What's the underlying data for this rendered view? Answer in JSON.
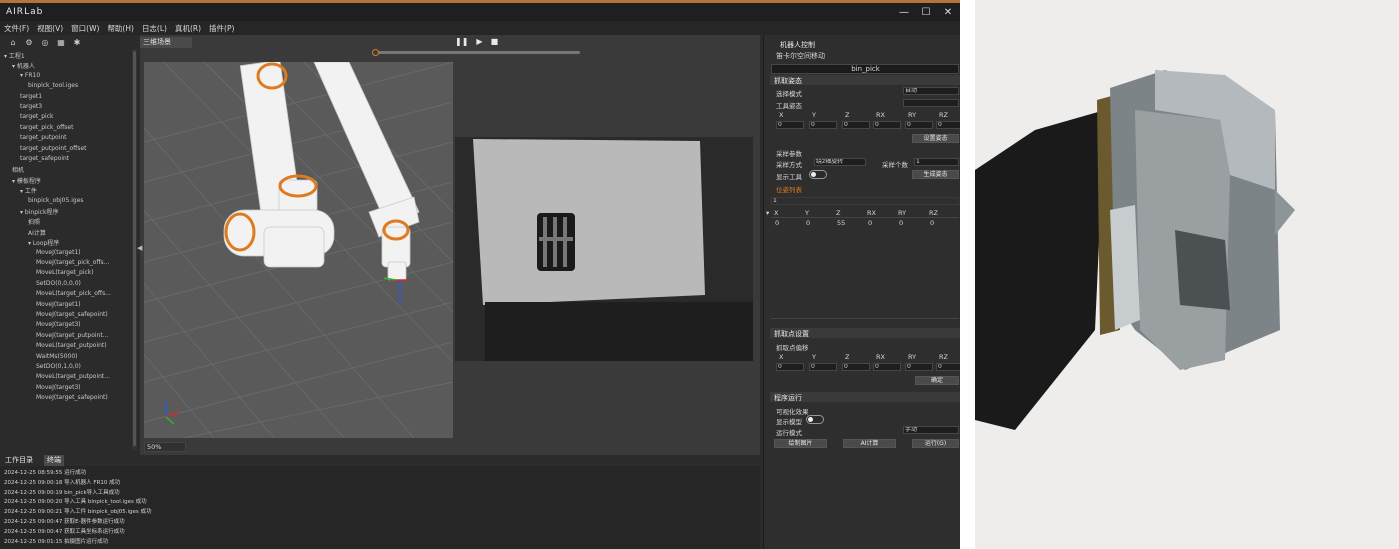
{
  "app": {
    "logo": "AIRLab",
    "window_buttons": [
      "—",
      "☐",
      "✕"
    ]
  },
  "menu": [
    "文件(F)",
    "视图(V)",
    "窗口(W)",
    "帮助(H)",
    "日志(L)",
    "真机(R)",
    "插件(P)"
  ],
  "toolbar_icons": [
    "home-icon",
    "gear-icon",
    "target-icon",
    "grid-icon",
    "settings-icon"
  ],
  "tree": [
    {
      "label": "工程1",
      "indent": 0,
      "arrow": "▾"
    },
    {
      "label": "机器人",
      "indent": 1,
      "arrow": "▾"
    },
    {
      "label": "FR10",
      "indent": 2,
      "arrow": "▾"
    },
    {
      "label": "binpick_tool.iges",
      "indent": 3,
      "arrow": ""
    },
    {
      "label": "target1",
      "indent": 2,
      "arrow": ""
    },
    {
      "label": "target3",
      "indent": 2,
      "arrow": ""
    },
    {
      "label": "target_pick",
      "indent": 2,
      "arrow": ""
    },
    {
      "label": "target_pick_offset",
      "indent": 2,
      "arrow": ""
    },
    {
      "label": "target_putpoint",
      "indent": 2,
      "arrow": ""
    },
    {
      "label": "target_putpoint_offset",
      "indent": 2,
      "arrow": ""
    },
    {
      "label": "target_safepoint",
      "indent": 2,
      "arrow": ""
    },
    {
      "label": "相机",
      "indent": 1,
      "arrow": ""
    },
    {
      "label": "模板程序",
      "indent": 1,
      "arrow": "▾"
    },
    {
      "label": "工件",
      "indent": 2,
      "arrow": "▾"
    },
    {
      "label": "binpick_obj05.iges",
      "indent": 3,
      "arrow": ""
    },
    {
      "label": "binpick程序",
      "indent": 2,
      "arrow": "▾"
    },
    {
      "label": "拍照",
      "indent": 3,
      "arrow": ""
    },
    {
      "label": "AI计算",
      "indent": 3,
      "arrow": ""
    },
    {
      "label": "Loop程序",
      "indent": 3,
      "arrow": "▾"
    },
    {
      "label": "MoveJ(target1)",
      "indent": 4,
      "arrow": ""
    },
    {
      "label": "MoveJ(target_pick_offs...",
      "indent": 4,
      "arrow": ""
    },
    {
      "label": "MoveL(target_pick)",
      "indent": 4,
      "arrow": ""
    },
    {
      "label": "SetDO(0,0,0,0)",
      "indent": 4,
      "arrow": ""
    },
    {
      "label": "MoveL(target_pick_offs...",
      "indent": 4,
      "arrow": ""
    },
    {
      "label": "MoveJ(target1)",
      "indent": 4,
      "arrow": ""
    },
    {
      "label": "MoveJ(target_safepoint)",
      "indent": 4,
      "arrow": ""
    },
    {
      "label": "MoveJ(target3)",
      "indent": 4,
      "arrow": ""
    },
    {
      "label": "MoveJ(target_putpoint...",
      "indent": 4,
      "arrow": ""
    },
    {
      "label": "MoveL(target_putpoint)",
      "indent": 4,
      "arrow": ""
    },
    {
      "label": "WaitMs(5000)",
      "indent": 4,
      "arrow": ""
    },
    {
      "label": "SetDO(0,1,0,0)",
      "indent": 4,
      "arrow": ""
    },
    {
      "label": "MoveL(target_putpoint...",
      "indent": 4,
      "arrow": ""
    },
    {
      "label": "MoveJ(target3)",
      "indent": 4,
      "arrow": ""
    },
    {
      "label": "MoveJ(target_safepoint)",
      "indent": 4,
      "arrow": ""
    }
  ],
  "scene": {
    "tab": "三维场景",
    "play_controls": [
      "❚❚",
      "▶",
      "■"
    ],
    "progress": 0.01,
    "zoom": "50%"
  },
  "right": {
    "header": "机器人控制",
    "cartesian": "笛卡尔空间移动",
    "program_select": "bin_pick",
    "sec_pose": "抓取姿态",
    "select_mode_label": "选择模式",
    "select_mode_value": "自动",
    "tool_pose_label": "工具姿态",
    "axes": [
      "X",
      "Y",
      "Z",
      "RX",
      "RY",
      "RZ"
    ],
    "pose_values": [
      "0",
      "0",
      "0",
      "0",
      "0",
      "0"
    ],
    "set_pose_btn": "设置姿态",
    "sample_params": "采样参数",
    "sample_method_label": "采样方式",
    "sample_method_value": "绕z轴旋转",
    "sample_count_label": "采样个数",
    "sample_count_value": "1",
    "show_tool_label": "显示工具",
    "gen_pose_btn": "生成姿态",
    "pose_list_label": "位姿列表",
    "list_count": "1",
    "list_headers": [
      "X",
      "Y",
      "Z",
      "RX",
      "RY",
      "RZ"
    ],
    "list_row": [
      "0",
      "0",
      "55",
      "0",
      "0",
      "0"
    ],
    "sec_grab": "抓取点设置",
    "grab_offset_label": "抓取点偏移",
    "grab_values": [
      "0",
      "0",
      "0",
      "0",
      "0",
      "0"
    ],
    "confirm_btn": "确定",
    "sec_run": "程序运行",
    "visual_label": "可视化效果",
    "show_model_label": "显示模型",
    "run_mode_label": "运行模式",
    "run_mode_value": "手动",
    "btn_draw": "绘制图片",
    "btn_ai": "AI计算",
    "btn_run": "运行(G)"
  },
  "bottom": {
    "tab1": "工作目录",
    "tab2": "终端",
    "logs": [
      "2024-12-25 08:59:55 运行成功",
      "2024-12-25 09:00:18 导入机器人 FR10 成功",
      "2024-12-25 09:00:19 bin_pick导入工具成功",
      "2024-12-25 09:00:20 导入工具 binpick_tool.iges 成功",
      "2024-12-25 09:00:21 导入工件 binpick_obj05.iges 成功",
      "2024-12-25 09:00:47 获取E-器件参数运行成功",
      "2024-12-25 09:00:47 获取工具坐标系运行成功",
      "2024-12-25 09:01:15 拍摄图片运行成功"
    ]
  },
  "colors": {
    "accent_orange": "#e07a20",
    "bg_dark": "#2b2b2b"
  }
}
